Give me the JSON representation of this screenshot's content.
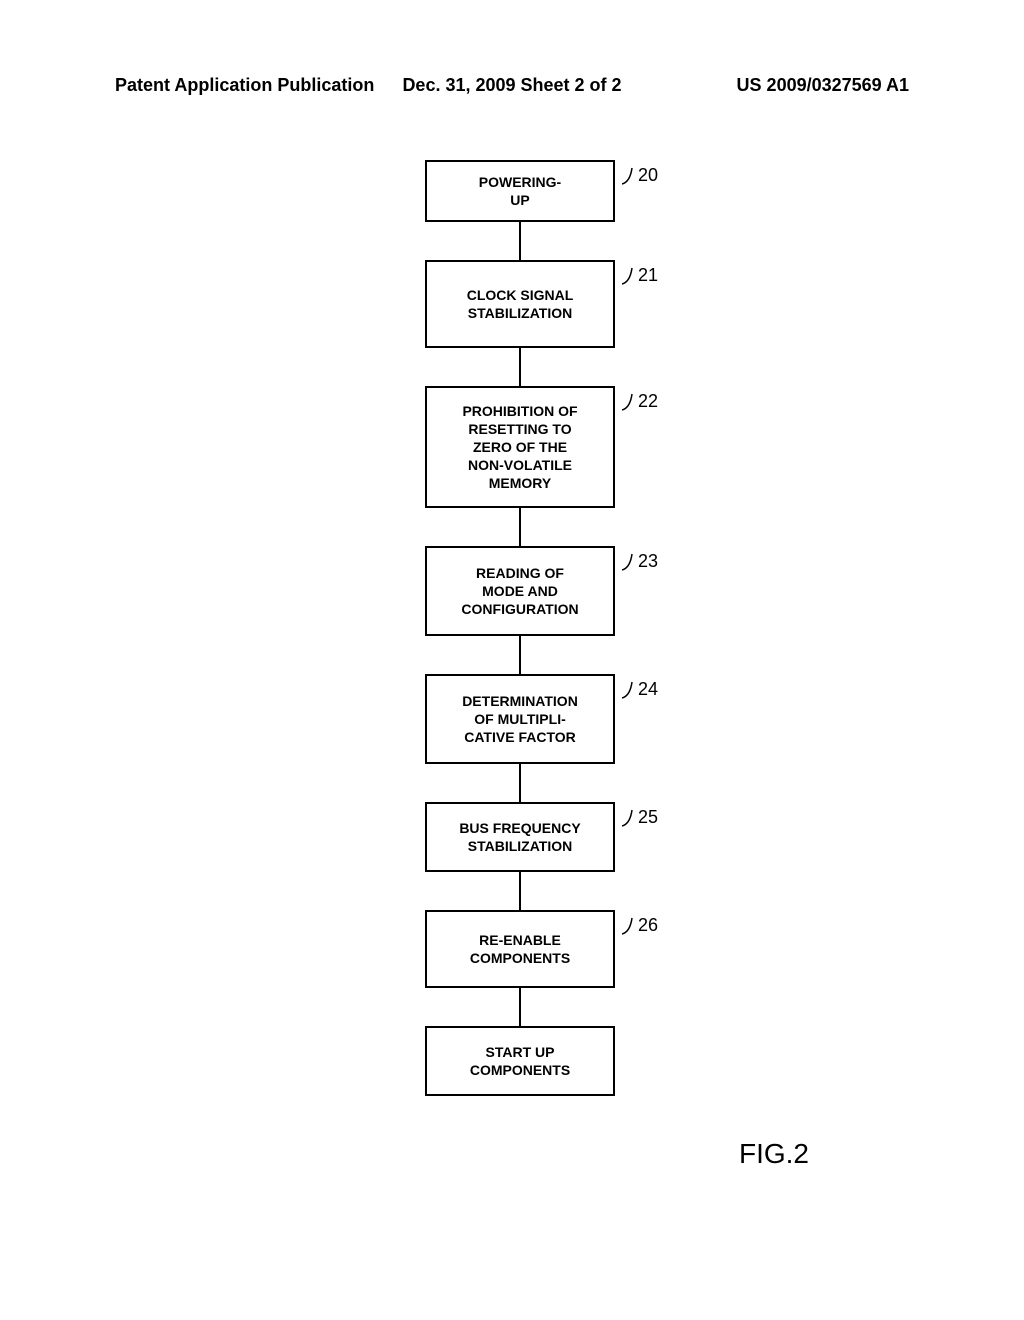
{
  "header": {
    "left": "Patent Application Publication",
    "center": "Dec. 31, 2009  Sheet 2 of 2",
    "right": "US 2009/0327569 A1"
  },
  "flowchart": {
    "steps": [
      {
        "id": "20",
        "label": "POWERING-\nUP",
        "ref": "20"
      },
      {
        "id": "21",
        "label": "CLOCK SIGNAL\nSTABILIZATION",
        "ref": "21"
      },
      {
        "id": "22",
        "label": "PROHIBITION OF\nRESETTING TO\nZERO OF THE\nNON-VOLATILE\nMEMORY",
        "ref": "22"
      },
      {
        "id": "23",
        "label": "READING OF\nMODE AND\nCONFIGURATION",
        "ref": "23"
      },
      {
        "id": "24",
        "label": "DETERMINATION\nOF MULTIPLI-\nCATIVE FACTOR",
        "ref": "24"
      },
      {
        "id": "25",
        "label": "BUS FREQUENCY\nSTABILIZATION",
        "ref": "25"
      },
      {
        "id": "26",
        "label": "RE-ENABLE\nCOMPONENTS",
        "ref": "26"
      },
      {
        "id": "27",
        "label": "START UP\nCOMPONENTS",
        "ref": ""
      }
    ]
  },
  "figure_label": "FIG.2"
}
